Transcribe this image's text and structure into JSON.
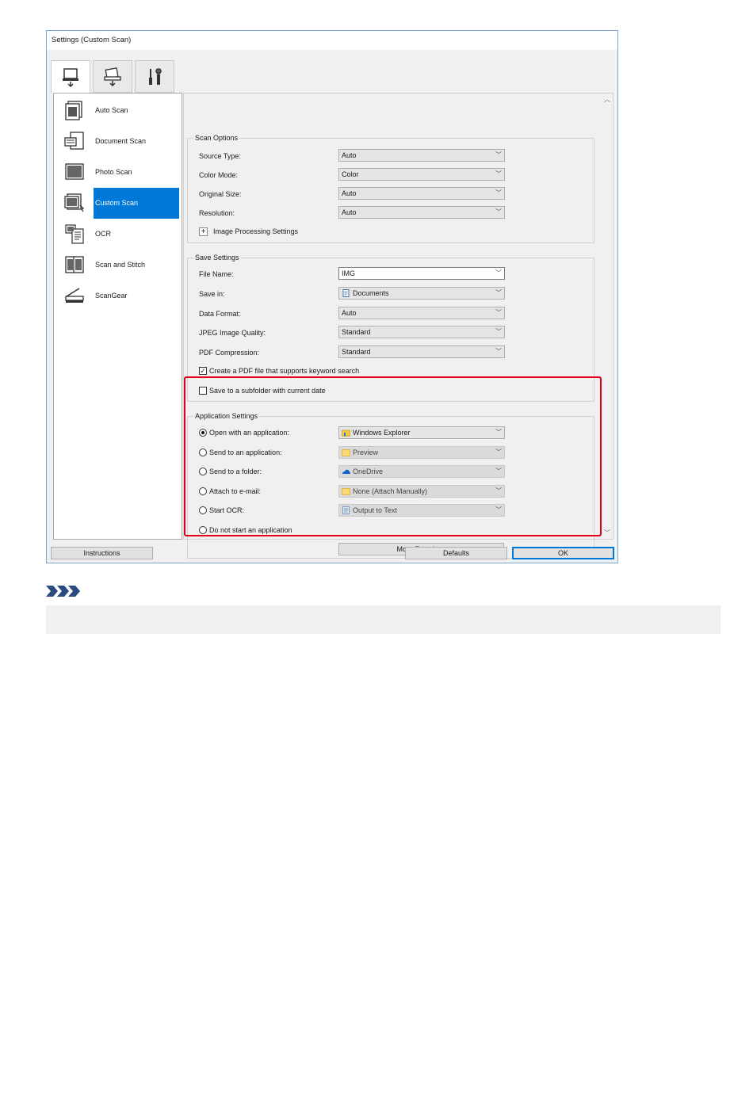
{
  "window": {
    "title": "Settings (Custom Scan)"
  },
  "tabs": [
    {
      "icon": "scan-from-computer-icon",
      "active": true
    },
    {
      "icon": "scan-from-panel-icon",
      "active": false
    },
    {
      "icon": "general-settings-icon",
      "active": false
    }
  ],
  "sidebar": {
    "items": [
      {
        "label": "Auto Scan",
        "icon": "auto-scan-icon"
      },
      {
        "label": "Document Scan",
        "icon": "document-scan-icon"
      },
      {
        "label": "Photo Scan",
        "icon": "photo-scan-icon"
      },
      {
        "label": "Custom Scan",
        "icon": "custom-scan-icon",
        "selected": true
      },
      {
        "label": "OCR",
        "icon": "ocr-icon"
      },
      {
        "label": "Scan and Stitch",
        "icon": "scan-and-stitch-icon"
      },
      {
        "label": "ScanGear",
        "icon": "scangear-icon"
      }
    ]
  },
  "scan_options": {
    "title": "Scan Options",
    "source_type": {
      "label": "Source Type:",
      "value": "Auto"
    },
    "color_mode": {
      "label": "Color Mode:",
      "value": "Color"
    },
    "original_size": {
      "label": "Original Size:",
      "value": "Auto"
    },
    "resolution": {
      "label": "Resolution:",
      "value": "Auto"
    },
    "image_processing": {
      "label": "Image Processing Settings"
    }
  },
  "save_settings": {
    "title": "Save Settings",
    "file_name": {
      "label": "File Name:",
      "value": "IMG"
    },
    "save_in": {
      "label": "Save in:",
      "value": "Documents"
    },
    "data_format": {
      "label": "Data Format:",
      "value": "Auto"
    },
    "jpeg_quality": {
      "label": "JPEG Image Quality:",
      "value": "Standard"
    },
    "pdf_compression": {
      "label": "PDF Compression:",
      "value": "Standard"
    },
    "keyword_pdf": {
      "label": "Create a PDF file that supports keyword search",
      "checked": true
    },
    "subfolder": {
      "label": "Save to a subfolder with current date",
      "checked": false
    }
  },
  "application_settings": {
    "title": "Application Settings",
    "options": [
      {
        "label": "Open with an application:",
        "selected": true,
        "value": "Windows Explorer",
        "icon": "windows-explorer-icon",
        "enabled": true
      },
      {
        "label": "Send to an application:",
        "selected": false,
        "value": "Preview",
        "icon": "folder-icon",
        "enabled": false
      },
      {
        "label": "Send to a folder:",
        "selected": false,
        "value": "OneDrive",
        "icon": "onedrive-icon",
        "enabled": false
      },
      {
        "label": "Attach to e-mail:",
        "selected": false,
        "value": "None (Attach Manually)",
        "icon": "folder-icon",
        "enabled": false
      },
      {
        "label": "Start OCR:",
        "selected": false,
        "value": "Output to Text",
        "icon": "text-document-icon",
        "enabled": false
      },
      {
        "label": "Do not start an application",
        "selected": false
      }
    ],
    "more_functions": "More Functions"
  },
  "footer": {
    "instructions": "Instructions",
    "defaults": "Defaults",
    "ok": "OK"
  },
  "colors": {
    "selection": "#0078d7",
    "highlight_box": "#e0001b",
    "note_icon": "#2b4a7e"
  },
  "note": {
    "icon": "note-chevrons-icon"
  }
}
